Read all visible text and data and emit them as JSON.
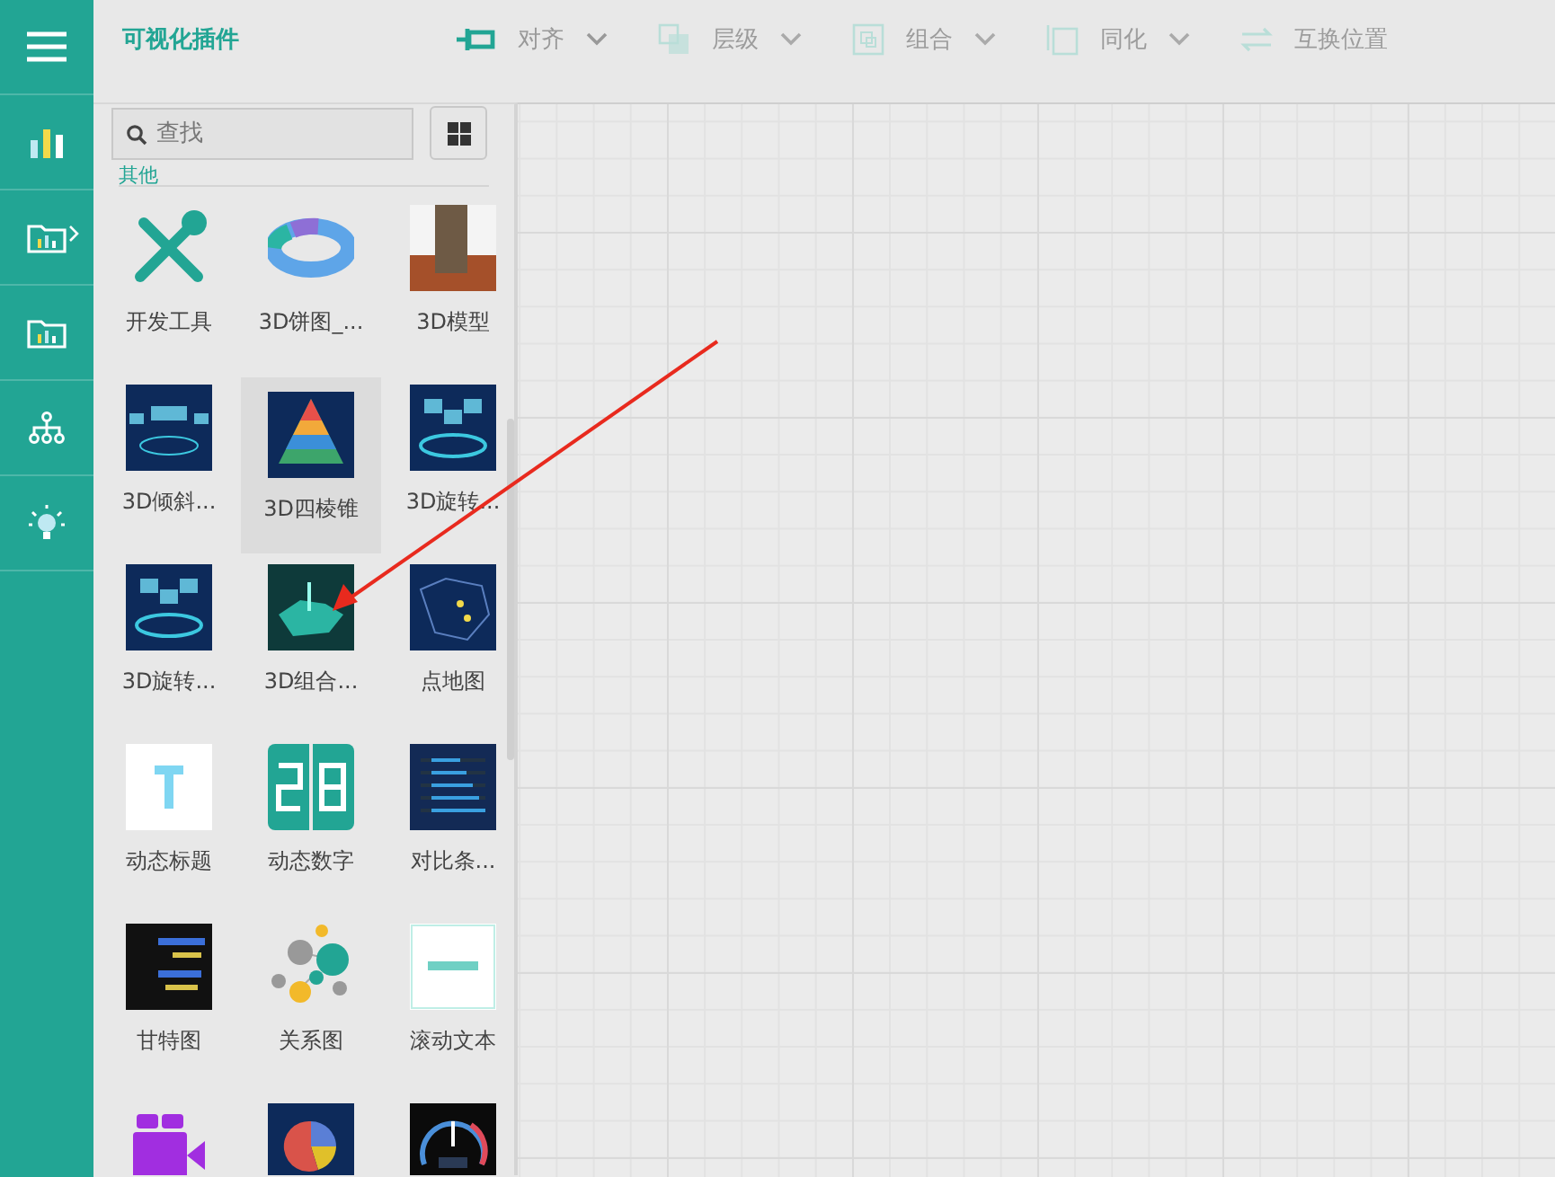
{
  "nav": [
    {
      "kind": "menu",
      "expandable": false
    },
    {
      "kind": "bar-chart",
      "expandable": false
    },
    {
      "kind": "folder-chart",
      "expandable": true
    },
    {
      "kind": "folder-chart",
      "expandable": false
    },
    {
      "kind": "tree",
      "expandable": false
    },
    {
      "kind": "bulb",
      "expandable": false
    }
  ],
  "panel_title": "可视化插件",
  "toolbar": [
    {
      "kind": "align",
      "label": "对齐",
      "disabled": false,
      "dropdown": true
    },
    {
      "kind": "layer",
      "label": "层级",
      "disabled": true,
      "dropdown": true
    },
    {
      "kind": "group",
      "label": "组合",
      "disabled": true,
      "dropdown": true
    },
    {
      "kind": "sync",
      "label": "同化",
      "disabled": true,
      "dropdown": true
    },
    {
      "kind": "swap",
      "label": "互换位置",
      "disabled": true,
      "dropdown": false
    }
  ],
  "search": {
    "placeholder": "查找"
  },
  "section_label": "其他",
  "widgets": [
    {
      "kind": "tools",
      "label": "开发工具",
      "selected": false
    },
    {
      "kind": "donut",
      "label": "3D饼图_...",
      "selected": false
    },
    {
      "kind": "photo",
      "label": "3D模型",
      "selected": false
    },
    {
      "kind": "tilt",
      "label": "3D倾斜...",
      "selected": false
    },
    {
      "kind": "pyramid",
      "label": "3D四棱锥",
      "selected": true
    },
    {
      "kind": "rotate",
      "label": "3D旋转...",
      "selected": false
    },
    {
      "kind": "rotate",
      "label": "3D旋转...",
      "selected": false
    },
    {
      "kind": "map3d",
      "label": "3D组合...",
      "selected": false
    },
    {
      "kind": "dotmap",
      "label": "点地图",
      "selected": false
    },
    {
      "kind": "title",
      "label": "动态标题",
      "selected": false
    },
    {
      "kind": "digits",
      "label": "动态数字",
      "selected": false
    },
    {
      "kind": "bars",
      "label": "对比条...",
      "selected": false
    },
    {
      "kind": "gantt",
      "label": "甘特图",
      "selected": false
    },
    {
      "kind": "graph",
      "label": "关系图",
      "selected": false
    },
    {
      "kind": "scrolltext",
      "label": "滚动文本",
      "selected": false
    },
    {
      "kind": "video",
      "selected": false
    },
    {
      "kind": "pie",
      "selected": false
    },
    {
      "kind": "gauge",
      "selected": false
    }
  ],
  "annotation_arrow": true
}
